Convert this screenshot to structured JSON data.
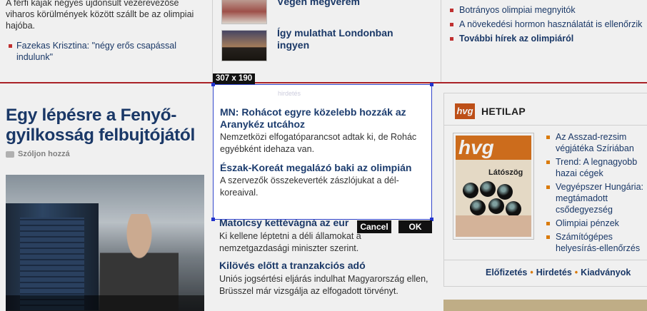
{
  "top": {
    "left": {
      "lead_text": "A férfi kajak négyes újdonsült vezérevezőse viharos körülmények között szállt be az olimpiai hajóba.",
      "bullet_link": "Fazekas Krisztina: \"négy erős csapással indulunk\""
    },
    "middle": {
      "items": [
        {
          "title": "Végén megverem"
        },
        {
          "title": "Így mulathat Londonban ingyen"
        }
      ]
    },
    "right": {
      "links": [
        "Botrányos olimpiai megnyitók",
        "A növekedési hormon használatát is ellenőrzik",
        "További hírek az olimpiáról"
      ]
    }
  },
  "left_column": {
    "headline": "Egy lépésre a Fenyő-gyilkosság felbujtójától",
    "comment_link": "Szóljon hozzá",
    "photo_caption": ""
  },
  "middle_column": {
    "articles": [
      {
        "title": "Matolcsy kettévágná az eur",
        "text": "Ki kellene léptetni a déli államokat a nemzetgazdasági miniszter szerint."
      },
      {
        "title": "Kilövés előtt a tranzakciós adó",
        "text": "Uniós jogsértési eljárás indulhat Magyarország ellen, Brüsszel már vizsgálja az elfogadott törvényt."
      }
    ]
  },
  "hvg": {
    "logo": "hvg",
    "label": "HETILAP",
    "cover": {
      "masthead": "hvg",
      "title": "Látószög"
    },
    "links": [
      "Az Asszad-rezsim végjátéka Szíriában",
      "Trend: A legnagyobb hazai cégek",
      "Vegyépszer Hungária: megtámadott csődegyezség",
      "Olimpiai pénzek",
      "Számítógépes helyesírás-ellenőrzés"
    ],
    "footer_links": [
      "Előfizetés",
      "Hirdetés",
      "Kiadványok"
    ],
    "separator": "•"
  },
  "selection": {
    "size_label": "307 x 190",
    "faint_text": "hirdetés",
    "articles": [
      {
        "title": "MN: Rohácot egyre közelebb hozzák az Aranykéz utcához",
        "text": "Nemzetközi elfogatóparancsot adtak ki, de Rohác egyébként idehaza van."
      },
      {
        "title": "Észak-Koreát megalázó baki az olimpián",
        "text": "A szervezők összekeverték zászlójukat a dél-koreaival."
      }
    ],
    "cancel_label": "Cancel",
    "ok_label": "OK"
  }
}
